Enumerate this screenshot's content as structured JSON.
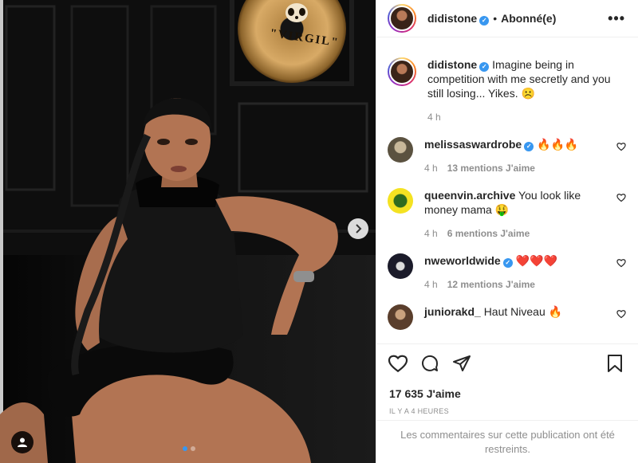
{
  "post": {
    "author": "didistone",
    "follow_state": "Abonné(e)",
    "bullet": "•",
    "more_icon": "more-horizontal-icon",
    "record_label": "\"VIRGIL\"",
    "caption": {
      "username": "didistone",
      "text": "Imagine being in competition with me secretly and you still losing... Yikes. ☹️",
      "time": "4 h"
    }
  },
  "comments": [
    {
      "username": "melissaswardrobe",
      "verified": true,
      "text": "🔥🔥🔥",
      "time": "4 h",
      "likes": "13 mentions J'aime"
    },
    {
      "username": "queenvin.archive",
      "verified": false,
      "text": "You look like money mama 🤑",
      "time": "4 h",
      "likes": "6 mentions J'aime"
    },
    {
      "username": "nweworldwide",
      "verified": true,
      "text": "❤️❤️❤️",
      "time": "4 h",
      "likes": "12 mentions J'aime"
    },
    {
      "username": "juniorakd_",
      "verified": false,
      "text": "Haut Niveau 🔥",
      "time": "",
      "likes": ""
    }
  ],
  "footer": {
    "likes": "17 635 J'aime",
    "timestamp": "IL Y A 4 HEURES",
    "restricted": "Les commentaires sur cette publication ont été restreints."
  },
  "colors": {
    "accent": "#3897f0",
    "text": "#262626",
    "muted": "#8e8e8e",
    "like": "#ed4956"
  }
}
